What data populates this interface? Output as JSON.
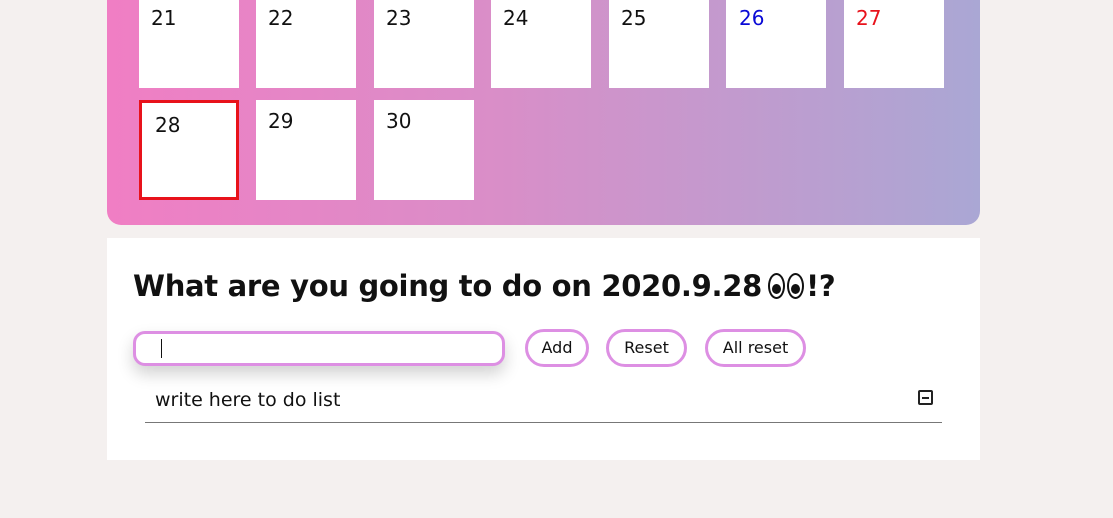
{
  "calendar": {
    "row1": [
      {
        "day": "21",
        "color": "#111111"
      },
      {
        "day": "22",
        "color": "#111111"
      },
      {
        "day": "23",
        "color": "#111111"
      },
      {
        "day": "24",
        "color": "#111111"
      },
      {
        "day": "25",
        "color": "#111111"
      },
      {
        "day": "26",
        "color": "#0a0ad6"
      },
      {
        "day": "27",
        "color": "#e8121b"
      }
    ],
    "row2": [
      {
        "day": "28",
        "selected": true
      },
      {
        "day": "29"
      },
      {
        "day": "30"
      }
    ],
    "selected_border_color": "#e8121b",
    "gradient_colors": [
      "#f07ec4",
      "#aaa7d4"
    ]
  },
  "todo": {
    "title": "What are you going to do on 2020.9.28",
    "title_suffix": "!?",
    "title_emoji": "eyes-icon",
    "input": {
      "value": "",
      "placeholder": ""
    },
    "buttons": {
      "add": "Add",
      "reset": "Reset",
      "all_reset": "All reset"
    },
    "items": [
      {
        "text": "write here to do list",
        "icon": "minus-square-icon"
      }
    ],
    "accent_color": "#dd8fe3"
  }
}
